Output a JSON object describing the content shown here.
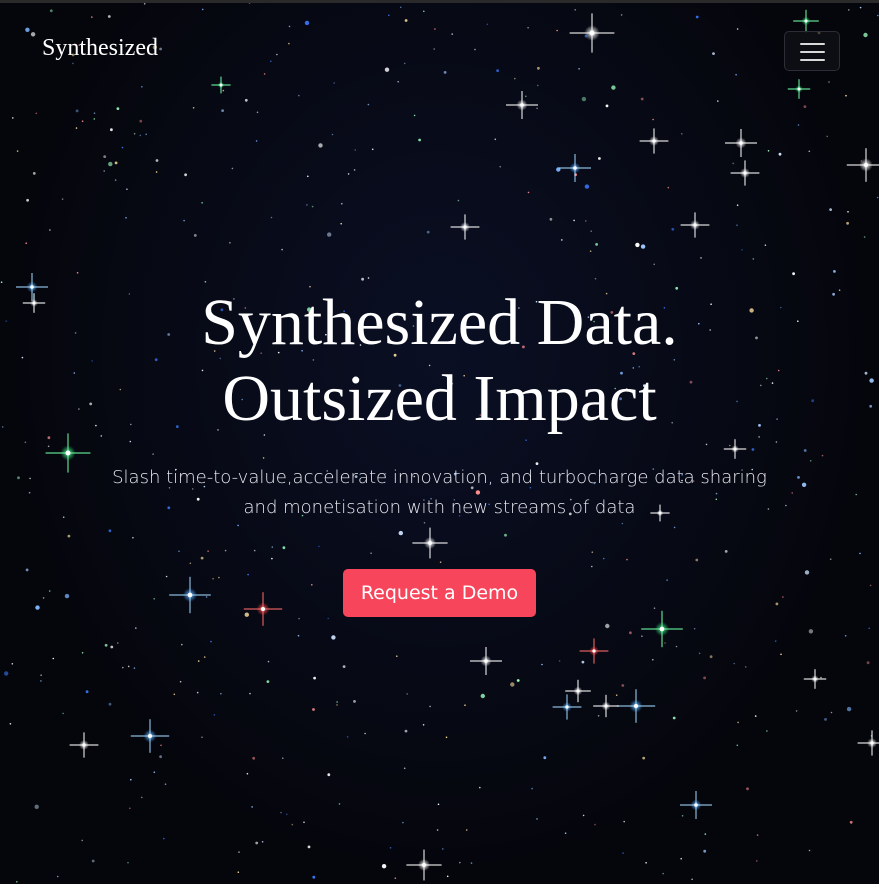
{
  "nav": {
    "brand": "Synthesized",
    "menu_icon": "hamburger-menu-icon"
  },
  "hero": {
    "title_line1": "Synthesized Data.",
    "title_line2": "Outsized Impact",
    "subtitle": "Slash time-to-value,accelerate innovation, and turbocharge data sharing and monetisation with new streams of data",
    "cta_label": "Request a Demo"
  },
  "colors": {
    "background": "#05060c",
    "text": "#ffffff",
    "cta": "#f7465c"
  },
  "background_image": "starfield"
}
